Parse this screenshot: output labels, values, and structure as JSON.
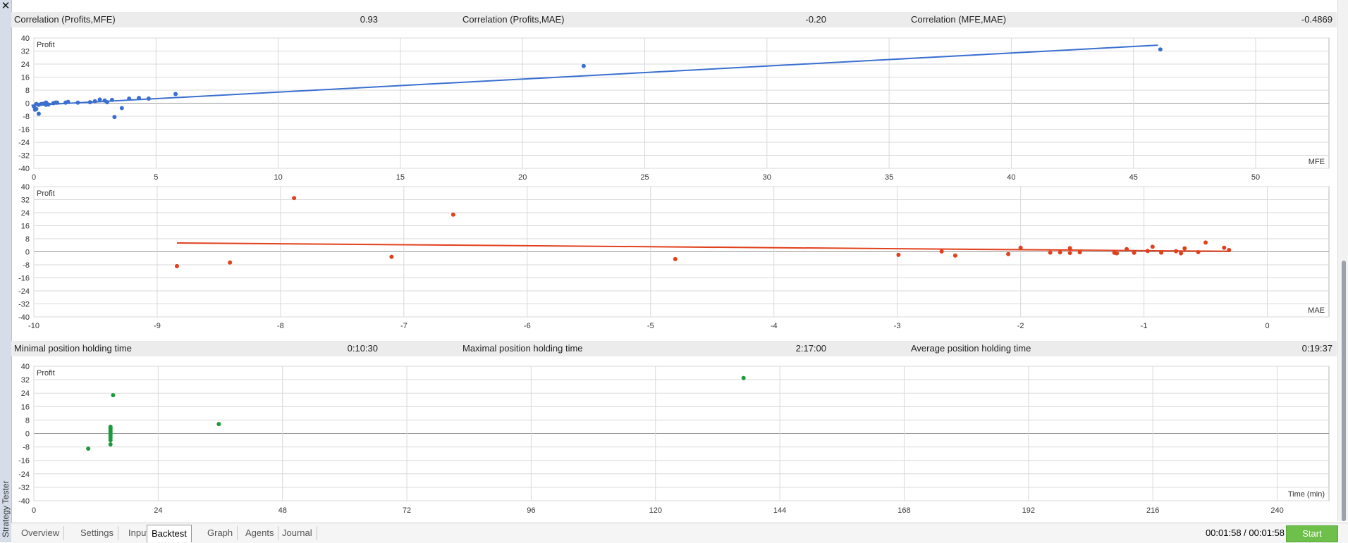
{
  "window": {
    "close_label": "✕",
    "side_label": "Strategy Tester"
  },
  "correlation_bar": {
    "items": [
      {
        "label": "Correlation (Profits,MFE)",
        "value": "0.93"
      },
      {
        "label": "Correlation (Profits,MAE)",
        "value": "-0.20"
      },
      {
        "label": "Correlation (MFE,MAE)",
        "value": "-0.4869"
      }
    ]
  },
  "holding_bar": {
    "items": [
      {
        "label": "Minimal position holding time",
        "value": "0:10:30"
      },
      {
        "label": "Maximal position holding time",
        "value": "2:17:00"
      },
      {
        "label": "Average position holding time",
        "value": "0:19:37"
      }
    ]
  },
  "colors": {
    "mfe": "#3a6fd0",
    "mae": "#e2401c",
    "time": "#1a9a3a",
    "grid": "#d9d9d9",
    "zero": "#9a9a9a"
  },
  "chart_data": [
    {
      "type": "scatter",
      "ylabel": "Profit",
      "xlabel": "MFE",
      "xlim": [
        0,
        53
      ],
      "ylim": [
        -40,
        40
      ],
      "xticks": [
        0,
        5,
        10,
        15,
        20,
        25,
        30,
        35,
        40,
        45,
        50
      ],
      "yticks": [
        40,
        32,
        24,
        16,
        8,
        0,
        -8,
        -16,
        -24,
        -32,
        -40
      ],
      "points": [
        [
          0,
          -2
        ],
        [
          0.05,
          -4
        ],
        [
          0.1,
          -3.5
        ],
        [
          0.1,
          -0.5
        ],
        [
          0.2,
          -1
        ],
        [
          0.2,
          -6.5
        ],
        [
          0.3,
          -0.5
        ],
        [
          0.4,
          -0.3
        ],
        [
          0.5,
          0
        ],
        [
          0.5,
          -1
        ],
        [
          0.5,
          0.4
        ],
        [
          0.6,
          -0.8
        ],
        [
          0.8,
          0
        ],
        [
          0.9,
          0.4
        ],
        [
          0.95,
          0.3
        ],
        [
          1.3,
          0.3
        ],
        [
          1.4,
          0.8
        ],
        [
          1.8,
          0.3
        ],
        [
          2.3,
          0.6
        ],
        [
          2.5,
          1.2
        ],
        [
          2.7,
          2.2
        ],
        [
          2.9,
          1.6
        ],
        [
          3.0,
          0.6
        ],
        [
          3.2,
          2
        ],
        [
          3.9,
          2.8
        ],
        [
          3.3,
          -8.5
        ],
        [
          3.6,
          -3
        ],
        [
          4.3,
          3.2
        ],
        [
          4.7,
          2.8
        ],
        [
          5.8,
          5.6
        ],
        [
          22.5,
          22.8
        ],
        [
          46.1,
          33
        ]
      ],
      "trendline": [
        [
          -0.1,
          -1.3
        ],
        [
          46,
          35.6
        ]
      ]
    },
    {
      "type": "scatter",
      "ylabel": "Profit",
      "xlabel": "MAE",
      "xlim": [
        -10,
        0.5
      ],
      "ylim": [
        -40,
        40
      ],
      "xticks": [
        -10,
        -9,
        -8,
        -7,
        -6,
        -5,
        -4,
        -3,
        -2,
        -1,
        0
      ],
      "yticks": [
        40,
        32,
        24,
        16,
        8,
        0,
        -8,
        -16,
        -24,
        -32,
        -40
      ],
      "points": [
        [
          -8.84,
          -8.8
        ],
        [
          -8.41,
          -6.6
        ],
        [
          -7.89,
          33
        ],
        [
          -7.1,
          -3.1
        ],
        [
          -6.6,
          22.8
        ],
        [
          -4.8,
          -4.5
        ],
        [
          -2.99,
          -1.9
        ],
        [
          -2.64,
          0.2
        ],
        [
          -2.53,
          -2.3
        ],
        [
          -2.1,
          -1.4
        ],
        [
          -2.0,
          2.5
        ],
        [
          -1.76,
          -0.5
        ],
        [
          -1.68,
          -0.4
        ],
        [
          -1.6,
          2.2
        ],
        [
          -1.6,
          -0.7
        ],
        [
          -1.52,
          -0.3
        ],
        [
          -1.24,
          -0.6
        ],
        [
          -1.22,
          -0.9
        ],
        [
          -1.14,
          1.6
        ],
        [
          -1.08,
          -0.6
        ],
        [
          -0.97,
          0.5
        ],
        [
          -0.93,
          3.1
        ],
        [
          -0.86,
          -0.5
        ],
        [
          -0.74,
          0.3
        ],
        [
          -0.7,
          -0.9
        ],
        [
          -0.67,
          2.1
        ],
        [
          -0.56,
          -0.2
        ],
        [
          -0.5,
          5.7
        ],
        [
          -0.35,
          2.5
        ],
        [
          -0.31,
          1.1
        ]
      ],
      "trendline": [
        [
          -8.84,
          5.4
        ],
        [
          -0.31,
          0.3
        ]
      ]
    },
    {
      "type": "scatter",
      "ylabel": "Profit",
      "xlabel": "Time (min)",
      "xlim": [
        0,
        250
      ],
      "ylim": [
        -40,
        40
      ],
      "xticks": [
        0,
        24,
        48,
        72,
        96,
        120,
        144,
        168,
        192,
        216,
        240
      ],
      "yticks": [
        40,
        32,
        24,
        16,
        8,
        0,
        -8,
        -16,
        -24,
        -32,
        -40
      ],
      "points": [
        [
          10.5,
          -9
        ],
        [
          14.8,
          -6.5
        ],
        [
          14.8,
          -4
        ],
        [
          14.8,
          -2.5
        ],
        [
          14.8,
          -1.2
        ],
        [
          14.8,
          0
        ],
        [
          14.8,
          1
        ],
        [
          14.8,
          2
        ],
        [
          14.8,
          3
        ],
        [
          14.8,
          4
        ],
        [
          15.3,
          22.8
        ],
        [
          35.7,
          5.6
        ],
        [
          137,
          33
        ]
      ]
    }
  ],
  "tabs": [
    {
      "label": "Overview",
      "active": false
    },
    {
      "label": "Settings",
      "active": false
    },
    {
      "label": "Inputs",
      "active": false
    },
    {
      "label": "Backtest",
      "active": true
    },
    {
      "label": "Graph",
      "active": false
    },
    {
      "label": "Agents",
      "active": false
    },
    {
      "label": "Journal",
      "active": false
    }
  ],
  "status": {
    "time": "00:01:58 / 00:01:58",
    "start_label": "Start"
  }
}
